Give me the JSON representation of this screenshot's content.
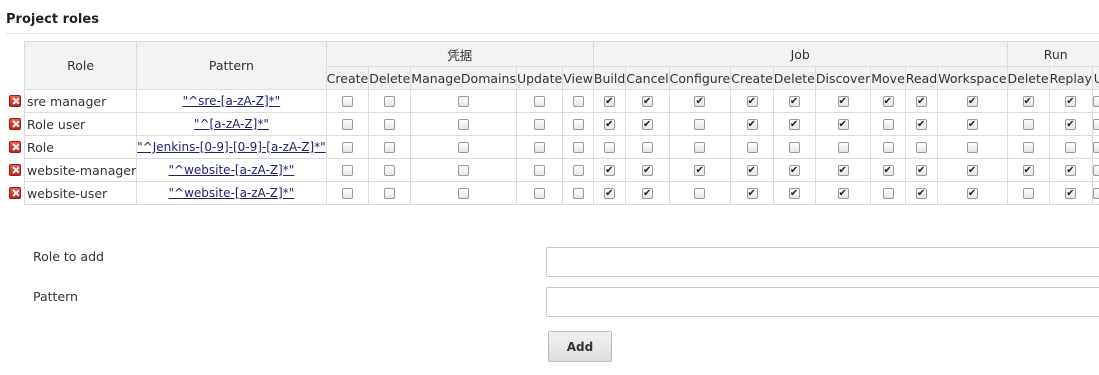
{
  "section": {
    "title": "Project roles"
  },
  "table": {
    "col_role": "Role",
    "col_pattern": "Pattern",
    "groups": [
      {
        "label": "凭据",
        "span": 5
      },
      {
        "label": "Job",
        "span": 11
      },
      {
        "label": "Run",
        "span": 3
      }
    ],
    "permissions": [
      "Create",
      "Delete",
      "ManageDomains",
      "Update",
      "View",
      "Build",
      "Cancel",
      "Configure",
      "Create",
      "Delete",
      "Discover",
      "Move",
      "Read",
      "Workspace",
      "Delete",
      "Replay",
      "U"
    ],
    "rows": [
      {
        "role": "sre manager",
        "pattern": "\"^sre-[a-zA-Z]*\"",
        "checks": [
          0,
          0,
          0,
          0,
          0,
          1,
          1,
          1,
          1,
          1,
          1,
          1,
          1,
          1,
          1,
          1,
          0
        ]
      },
      {
        "role": "Role user",
        "pattern": "\"^[a-zA-Z]*\"",
        "checks": [
          0,
          0,
          0,
          0,
          0,
          1,
          1,
          0,
          1,
          1,
          1,
          0,
          1,
          1,
          0,
          1,
          0
        ]
      },
      {
        "role": "Role",
        "pattern": "\"^Jenkins-[0-9]-[0-9]-[a-zA-Z]*\"",
        "checks": [
          0,
          0,
          0,
          0,
          0,
          0,
          0,
          0,
          0,
          0,
          0,
          0,
          0,
          0,
          0,
          0,
          0
        ]
      },
      {
        "role": "website-manager",
        "pattern": "\"^website-[a-zA-Z]*\"",
        "checks": [
          0,
          0,
          0,
          0,
          0,
          1,
          1,
          1,
          1,
          1,
          1,
          1,
          1,
          1,
          1,
          1,
          0
        ]
      },
      {
        "role": "website-user",
        "pattern": "\"^website-[a-zA-Z]*\"",
        "checks": [
          0,
          0,
          0,
          0,
          0,
          1,
          1,
          0,
          1,
          1,
          1,
          0,
          1,
          1,
          0,
          1,
          0
        ]
      }
    ]
  },
  "form": {
    "role_label": "Role to add",
    "pattern_label": "Pattern",
    "role_value": "",
    "pattern_value": "",
    "add_label": "Add"
  },
  "colors": {
    "header_bg": "#f2f2f2",
    "border": "#dcdcdc",
    "delete_red": "#d9342b",
    "link": "#1f1f6e"
  }
}
